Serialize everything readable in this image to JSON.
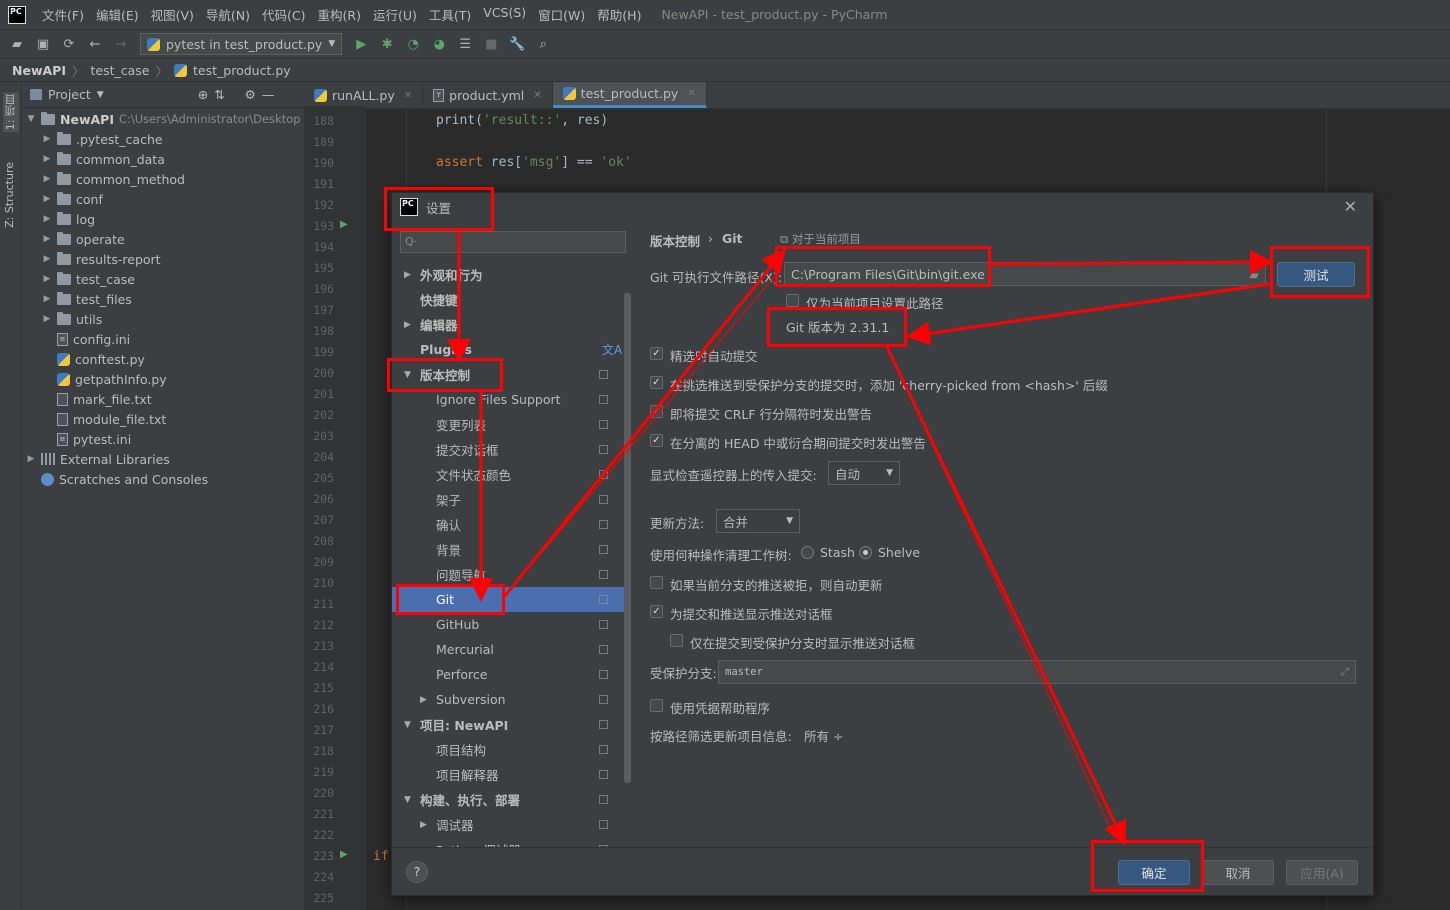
{
  "menubar": {
    "logo": "PC",
    "items": [
      "文件(F)",
      "编辑(E)",
      "视图(V)",
      "导航(N)",
      "代码(C)",
      "重构(R)",
      "运行(U)",
      "工具(T)",
      "VCS(S)",
      "窗口(W)",
      "帮助(H)"
    ],
    "window_title": "NewAPI - test_product.py - PyCharm"
  },
  "toolbar": {
    "run_config": "pytest in test_product.py"
  },
  "breadcrumb": [
    "NewAPI",
    "test_case",
    "test_product.py"
  ],
  "sidebar_tabs": {
    "project": "1: 项目",
    "structure": "Z: Structure"
  },
  "project_panel": {
    "title": "Project",
    "root": {
      "name": "NewAPI",
      "path": "C:\\Users\\Administrator\\Desktop"
    },
    "items": [
      {
        "name": ".pytest_cache",
        "kind": "folder"
      },
      {
        "name": "common_data",
        "kind": "folder"
      },
      {
        "name": "common_method",
        "kind": "folder"
      },
      {
        "name": "conf",
        "kind": "folder"
      },
      {
        "name": "log",
        "kind": "folder"
      },
      {
        "name": "operate",
        "kind": "folder"
      },
      {
        "name": "results-report",
        "kind": "folder"
      },
      {
        "name": "test_case",
        "kind": "folder"
      },
      {
        "name": "test_files",
        "kind": "folder"
      },
      {
        "name": "utils",
        "kind": "folder"
      },
      {
        "name": "config.ini",
        "kind": "ini"
      },
      {
        "name": "conftest.py",
        "kind": "py"
      },
      {
        "name": "getpathInfo.py",
        "kind": "py"
      },
      {
        "name": "mark_file.txt",
        "kind": "txt"
      },
      {
        "name": "module_file.txt",
        "kind": "txt"
      },
      {
        "name": "pytest.ini",
        "kind": "ini"
      }
    ],
    "external": "External Libraries",
    "scratches": "Scratches and Consoles"
  },
  "editor_tabs": [
    {
      "label": "runALL.py"
    },
    {
      "label": "product.yml"
    },
    {
      "label": "test_product.py",
      "active": true
    }
  ],
  "editor": {
    "line_numbers": [
      "188",
      "189",
      "190",
      "191",
      "192",
      "193",
      "194",
      "195",
      "196",
      "197",
      "198",
      "199",
      "200",
      "201",
      "202",
      "203",
      "204",
      "205",
      "206",
      "207",
      "208",
      "209",
      "210",
      "211",
      "212",
      "213",
      "214",
      "215",
      "216",
      "217",
      "218",
      "219",
      "220",
      "221",
      "222",
      "223",
      "224",
      "225"
    ],
    "line1": {
      "fn": "print(",
      "s": "'result::'",
      ", res)": ", res)"
    },
    "line3": {
      "kw": "assert",
      " rest": " res[",
      "s": "'msg'",
      "eq": "] == ",
      "ok": "'ok'"
    },
    "if_kw": "if"
  },
  "dialog": {
    "title": "设置",
    "search_placeholder": "Q·",
    "nav": [
      {
        "label": "外观和行为",
        "arrow": "▶",
        "level": 0
      },
      {
        "label": "快捷键",
        "arrow": "",
        "level": 0
      },
      {
        "label": "编辑器",
        "arrow": "▶",
        "level": 0
      },
      {
        "label": "Plugins",
        "arrow": "",
        "level": 0
      },
      {
        "label": "版本控制",
        "arrow": "▼",
        "level": 0
      },
      {
        "label": "Ignore Files Support",
        "arrow": "",
        "level": 1
      },
      {
        "label": "变更列表",
        "arrow": "",
        "level": 1
      },
      {
        "label": "提交对话框",
        "arrow": "",
        "level": 1
      },
      {
        "label": "文件状态颜色",
        "arrow": "",
        "level": 1
      },
      {
        "label": "架子",
        "arrow": "",
        "level": 1
      },
      {
        "label": "确认",
        "arrow": "",
        "level": 1
      },
      {
        "label": "背景",
        "arrow": "",
        "level": 1
      },
      {
        "label": "问题导航",
        "arrow": "",
        "level": 1
      },
      {
        "label": "Git",
        "arrow": "",
        "level": 1,
        "selected": true
      },
      {
        "label": "GitHub",
        "arrow": "",
        "level": 1
      },
      {
        "label": "Mercurial",
        "arrow": "",
        "level": 1
      },
      {
        "label": "Perforce",
        "arrow": "",
        "level": 1
      },
      {
        "label": "Subversion",
        "arrow": "▶",
        "level": 1
      },
      {
        "label": "项目: NewAPI",
        "arrow": "▼",
        "level": 0
      },
      {
        "label": "项目结构",
        "arrow": "",
        "level": 1
      },
      {
        "label": "项目解释器",
        "arrow": "",
        "level": 1
      },
      {
        "label": "构建、执行、部署",
        "arrow": "▼",
        "level": 0
      },
      {
        "label": "调试器",
        "arrow": "▶",
        "level": 1
      },
      {
        "label": "Python 调试器",
        "arrow": "",
        "level": 1
      }
    ],
    "crumb_parent": "版本控制",
    "crumb_sep": "›",
    "crumb_current": "Git",
    "crumb_note": "对于当前项目",
    "git_path_label": "Git 可执行文件路径(X):",
    "git_path_value": "C:\\Program Files\\Git\\bin\\git.exe",
    "test_button": "测试",
    "only_project_path": "仅为当前项目设置此路径",
    "git_version": "Git 版本为 2.31.1",
    "opt_auto_commit": "精选时自动提交",
    "opt_cherry_pick": "在挑选推送到受保护分支的提交时，添加 'cherry-picked from <hash>' 后缀",
    "opt_crlf": "即将提交 CRLF 行分隔符时发出警告",
    "opt_detached": "在分离的 HEAD 中或衍合期间提交时发出警告",
    "incoming_label": "显式检查遥控器上的传入提交:",
    "incoming_value": "自动",
    "update_label": "更新方法:",
    "update_value": "合并",
    "clean_label": "使用何种操作清理工作树:",
    "stash": "Stash",
    "shelve": "Shelve",
    "opt_auto_update": "如果当前分支的推送被拒，则自动更新",
    "opt_push_dialog": "为提交和推送显示推送对话框",
    "opt_push_protected": "仅在提交到受保护分支时显示推送对话框",
    "protected_label": "受保护分支:",
    "protected_value": "master",
    "opt_credential": "使用凭据帮助程序",
    "filter_label": "按路径筛选更新项目信息:",
    "filter_value": "所有 ÷",
    "help": "?",
    "ok": "确定",
    "cancel": "取消",
    "apply": "应用(A)"
  },
  "colors": {
    "annotation": "#ff0000",
    "selection": "#4b6eaf",
    "accent": "#4a88c7"
  }
}
